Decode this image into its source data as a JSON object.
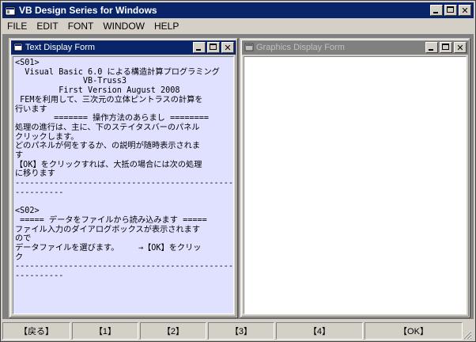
{
  "app": {
    "title": "VB Design Series for Windows",
    "menu": [
      "FILE",
      "EDIT",
      "FONT",
      "WINDOW",
      "HELP"
    ]
  },
  "text_form": {
    "title": "Text Display Form",
    "content": "<S01>\n  Visual Basic 6.0 による構造計算プログラミング\n              VB-Truss3\n         First Version August 2008\n FEMを利用して、三次元の立体ピントラスの計算を\n行います\n        ======= 操作方法のあらまし ========\n処理の進行は、主に、下のステイタスバーのパネル\nクリックします。\nどのパネルが何をするか、の説明が随時表示されま\nす\n【OK】をクリックすれば、大抵の場合には次の処理\nに移ります\n------------------------------------------------\n----------\n\n<S02>\n ===== データをファイルから読み込みます =====\nファイル入力のダイアログボックスが表示されます\nので\nデータファイルを選びます。    →【OK】をクリッ\nク\n------------------------------------------------\n----------"
  },
  "graphics_form": {
    "title": "Graphics Display Form"
  },
  "status_bar": {
    "panels": [
      "【戻る】",
      "【1】",
      "【2】",
      "【3】",
      "【4】",
      "【OK】"
    ]
  },
  "colors": {
    "active_title": "#0a246a",
    "inactive_title": "#808080",
    "text_bg": "#e0e0ff",
    "face": "#d4d0c8"
  }
}
